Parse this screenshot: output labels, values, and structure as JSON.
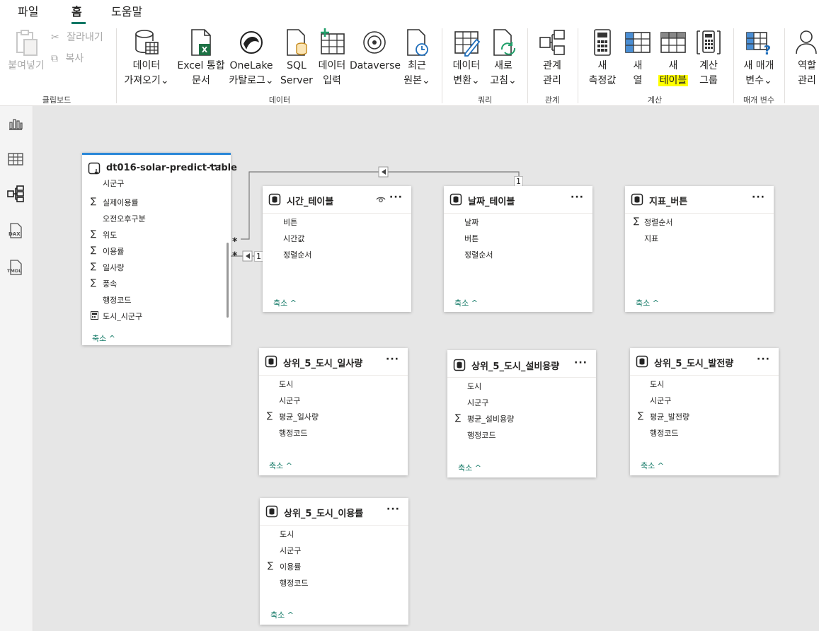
{
  "menu_tabs": [
    "파일",
    "홈",
    "도움말"
  ],
  "ribbon": {
    "clipboard": {
      "paste": "붙여넣기",
      "cut": "잘라내기",
      "copy": "복사",
      "group": "클립보드"
    },
    "data": {
      "get_data": [
        "데이터",
        "가져오기"
      ],
      "excel": [
        "Excel 통합",
        "문서"
      ],
      "onelake": [
        "OneLake",
        "카탈로그"
      ],
      "sql": [
        "SQL",
        "Server"
      ],
      "enter_data": [
        "데이터",
        "입력"
      ],
      "dataverse": "Dataverse",
      "recent": [
        "최근",
        "원본"
      ],
      "group": "데이터"
    },
    "queries": {
      "transform": [
        "데이터",
        "변환"
      ],
      "refresh": [
        "새로",
        "고침"
      ],
      "group": "쿼리"
    },
    "relationships": {
      "manage": [
        "관계",
        "관리"
      ],
      "group": "관계"
    },
    "calculations": {
      "new_measure": [
        "새",
        "측정값"
      ],
      "new_column": [
        "새",
        "열"
      ],
      "new_table": [
        "새",
        "테이블"
      ],
      "calc_group": [
        "계산",
        "그룹"
      ],
      "group": "계산"
    },
    "parameters": {
      "new_param": [
        "새 매개",
        "변수"
      ],
      "group": "매개 변수"
    },
    "security": {
      "roles": [
        "역할",
        "관리"
      ]
    }
  },
  "left_nav": [
    "report-view-icon",
    "table-view-icon",
    "model-view-icon",
    "dax-query-icon",
    "tmdl-view-icon"
  ],
  "relationship": {
    "many": "*",
    "one": "1"
  },
  "collapse_label": "축소",
  "tables": [
    {
      "name": "dt016-solar-predict-table",
      "fields": [
        {
          "name": "시군구",
          "sigma": false
        },
        {
          "name": "실제이용률",
          "sigma": true
        },
        {
          "name": "오전오후구분",
          "sigma": false
        },
        {
          "name": "위도",
          "sigma": true
        },
        {
          "name": "이용률",
          "sigma": true
        },
        {
          "name": "일사량",
          "sigma": true
        },
        {
          "name": "풍속",
          "sigma": true
        },
        {
          "name": "행정코드",
          "sigma": false
        },
        {
          "name": "도시_시군구",
          "sigma": false,
          "calc": true
        }
      ]
    },
    {
      "name": "시간_테이블",
      "fields": [
        {
          "name": "비튼"
        },
        {
          "name": "시간값"
        },
        {
          "name": "정렬순서"
        }
      ]
    },
    {
      "name": "날짜_테이블",
      "fields": [
        {
          "name": "날짜"
        },
        {
          "name": "버튼"
        },
        {
          "name": "정렬순서"
        }
      ]
    },
    {
      "name": "지표_버튼",
      "fields": [
        {
          "name": "정렬순서",
          "sigma": true
        },
        {
          "name": "지표"
        }
      ]
    },
    {
      "name": "상위_5_도시_일사량",
      "fields": [
        {
          "name": "도시"
        },
        {
          "name": "시군구"
        },
        {
          "name": "평균_일사량",
          "sigma": true
        },
        {
          "name": "행정코드"
        }
      ]
    },
    {
      "name": "상위_5_도시_설비용량",
      "fields": [
        {
          "name": "도시"
        },
        {
          "name": "시군구"
        },
        {
          "name": "평균_설비용량",
          "sigma": true
        },
        {
          "name": "행정코드"
        }
      ]
    },
    {
      "name": "상위_5_도시_발전량",
      "fields": [
        {
          "name": "도시"
        },
        {
          "name": "시군구"
        },
        {
          "name": "평균_발전량",
          "sigma": true
        },
        {
          "name": "행정코드"
        }
      ]
    },
    {
      "name": "상위_5_도시_이용률",
      "fields": [
        {
          "name": "도시"
        },
        {
          "name": "시군구"
        },
        {
          "name": "이용률",
          "sigma": true
        },
        {
          "name": "행정코드"
        }
      ]
    }
  ]
}
